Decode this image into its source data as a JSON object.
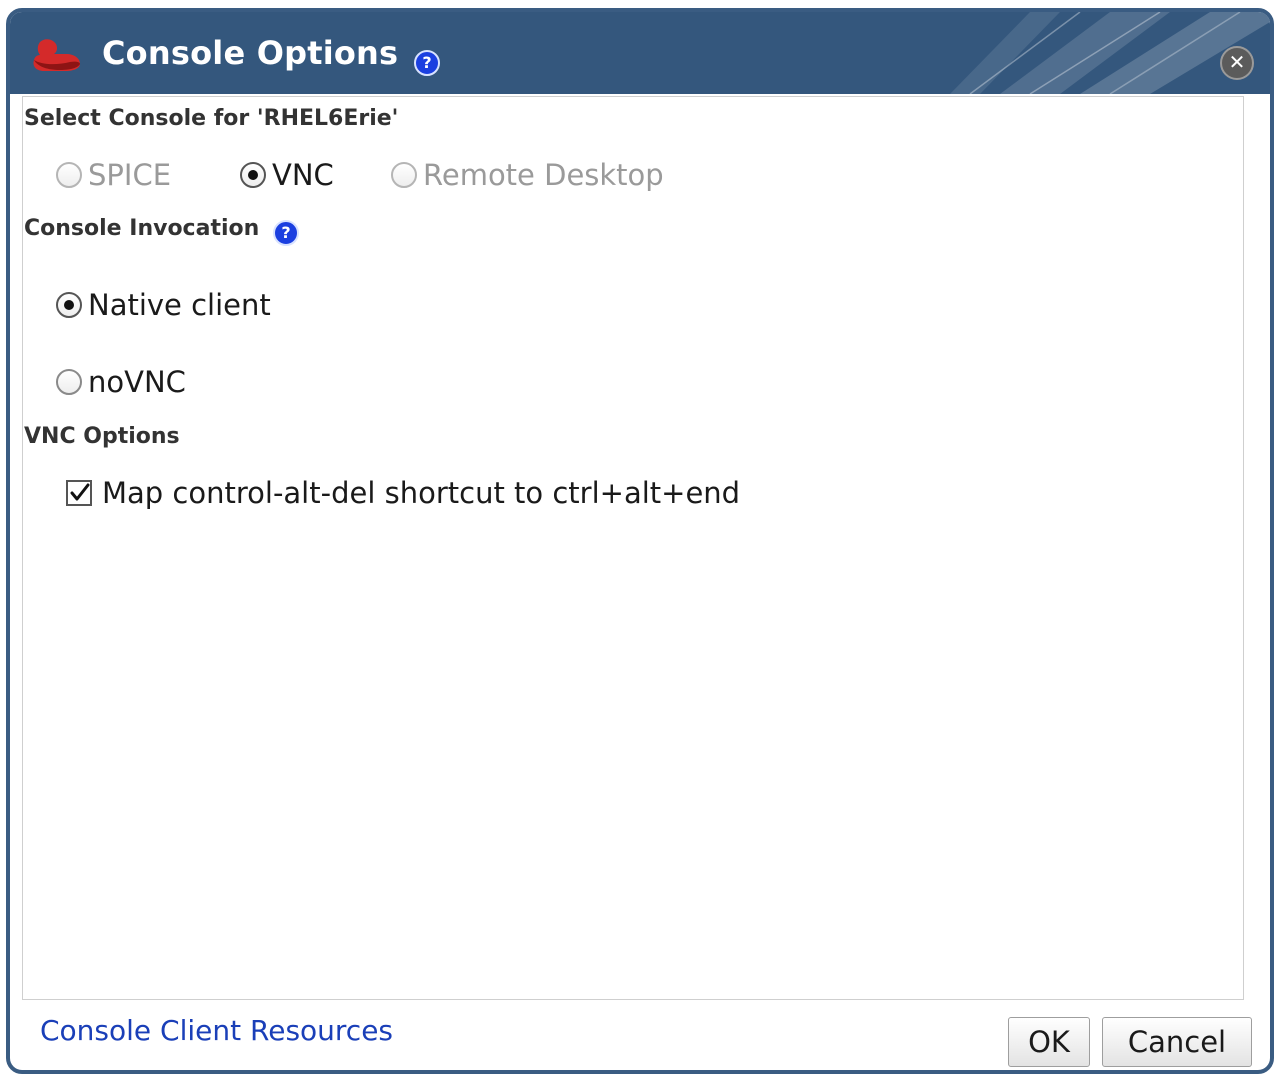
{
  "dialog": {
    "title": "Console Options",
    "help_icon": "question-circle-icon",
    "close_icon": "close-circle-icon",
    "title_bar_color": "#34577d",
    "logo_color": "#d42a2a"
  },
  "console_select": {
    "heading": "Select Console for 'RHEL6Erie'",
    "options": [
      {
        "label": "SPICE",
        "checked": false,
        "enabled": false
      },
      {
        "label": "VNC",
        "checked": true,
        "enabled": true
      },
      {
        "label": "Remote Desktop",
        "checked": false,
        "enabled": false
      }
    ]
  },
  "invocation": {
    "heading": "Console Invocation",
    "options": [
      {
        "label": "Native client",
        "checked": true
      },
      {
        "label": "noVNC",
        "checked": false
      }
    ]
  },
  "vnc_options": {
    "heading": "VNC Options",
    "map_ctrl_alt_del": {
      "label": "Map control-alt-del shortcut to ctrl+alt+end",
      "checked": true
    }
  },
  "footer": {
    "resources_link": "Console Client Resources",
    "ok_label": "OK",
    "cancel_label": "Cancel",
    "link_color": "#1a3fb8"
  }
}
